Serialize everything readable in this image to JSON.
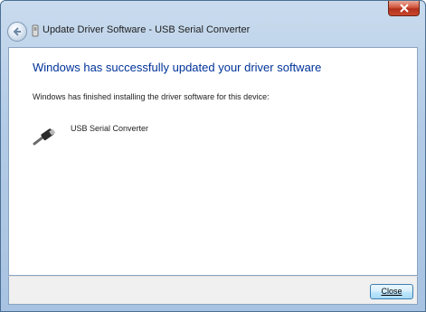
{
  "window": {
    "title": "Update Driver Software - USB Serial Converter"
  },
  "content": {
    "heading": "Windows has successfully updated your driver software",
    "subtext": "Windows has finished installing the driver software for this device:",
    "device_name": "USB Serial Converter",
    "device_icon": "usb-connector-icon"
  },
  "footer": {
    "close_label": "Close"
  },
  "colors": {
    "heading": "#003399",
    "titlebar": "#b3cbe6",
    "close_x": "#c9482c"
  }
}
